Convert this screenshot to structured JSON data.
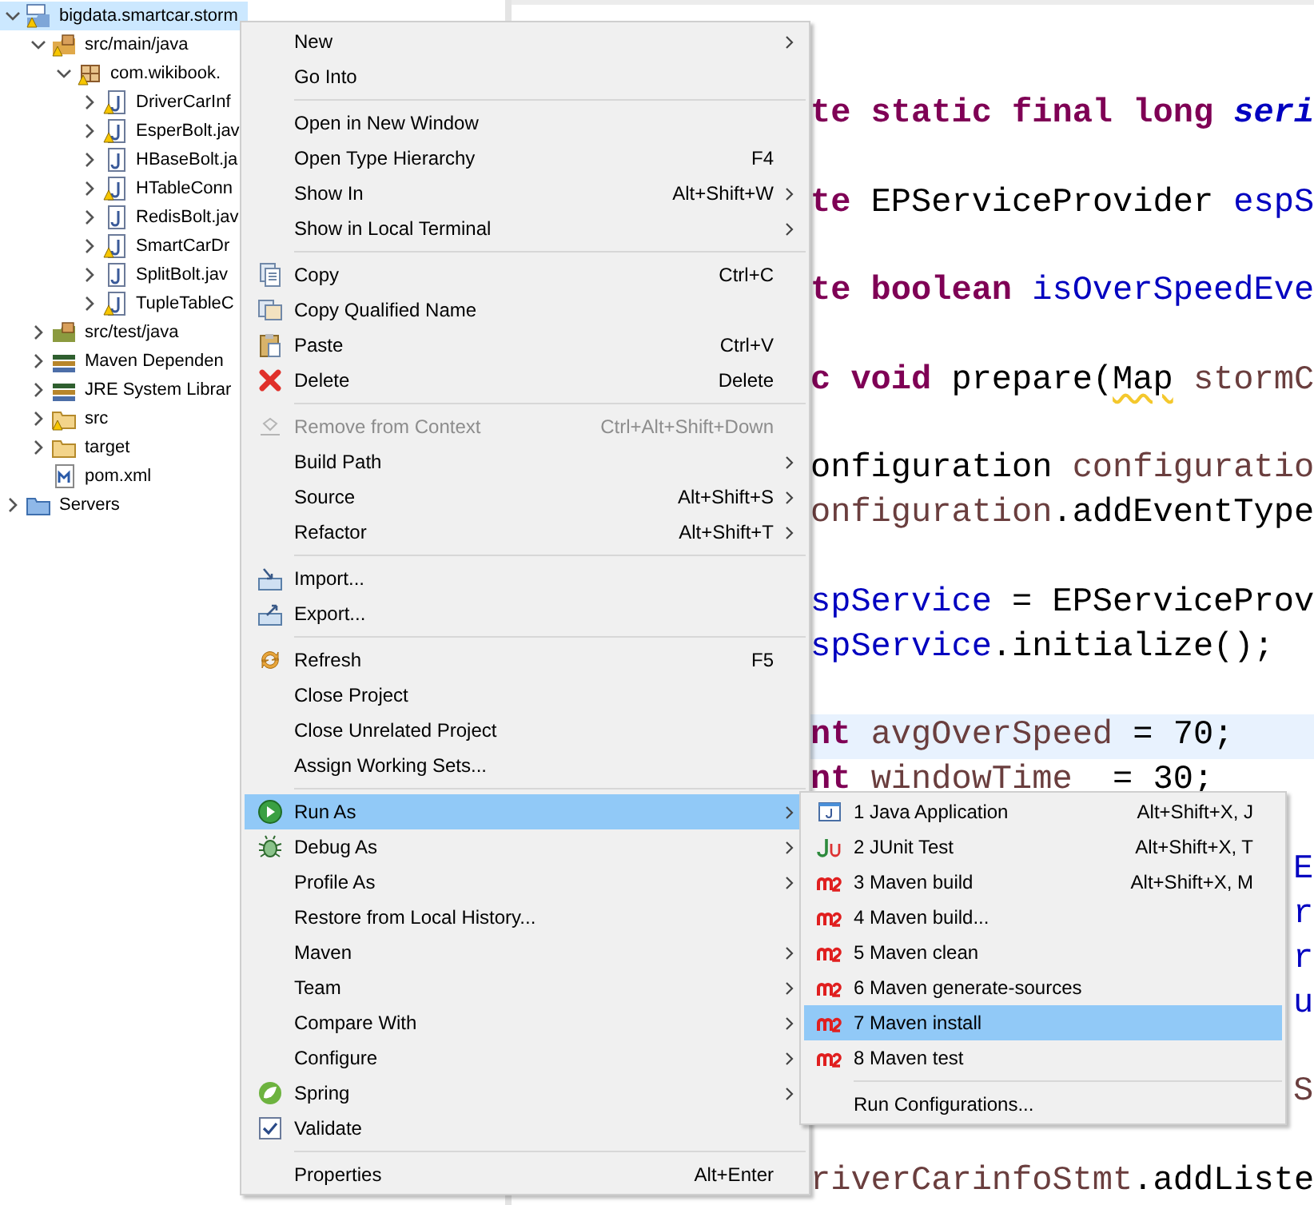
{
  "tree": [
    {
      "kind": "project",
      "label": "bigdata.smartcar.storm",
      "expanded": true,
      "selected": true,
      "warning": true,
      "children": [
        {
          "kind": "source-folder",
          "label": "src/main/java",
          "expanded": true,
          "selected": false,
          "warning": true,
          "children": [
            {
              "kind": "package",
              "label": "com.wikibook.",
              "expanded": true,
              "selected": false,
              "warning": true,
              "children": [
                {
                  "kind": "java",
                  "label": "DriverCarInf",
                  "expanded": false,
                  "selected": false,
                  "warning": true
                },
                {
                  "kind": "java",
                  "label": "EsperBolt.jav",
                  "expanded": false,
                  "selected": false,
                  "warning": true
                },
                {
                  "kind": "java",
                  "label": "HBaseBolt.ja",
                  "expanded": false,
                  "selected": false,
                  "warning": false
                },
                {
                  "kind": "java",
                  "label": "HTableConn",
                  "expanded": false,
                  "selected": false,
                  "warning": true
                },
                {
                  "kind": "java",
                  "label": "RedisBolt.jav",
                  "expanded": false,
                  "selected": false,
                  "warning": false
                },
                {
                  "kind": "java",
                  "label": "SmartCarDr",
                  "expanded": false,
                  "selected": false,
                  "warning": true
                },
                {
                  "kind": "java",
                  "label": "SplitBolt.jav",
                  "expanded": false,
                  "selected": false,
                  "warning": false
                },
                {
                  "kind": "java",
                  "label": "TupleTableC",
                  "expanded": false,
                  "selected": false,
                  "warning": true
                }
              ]
            }
          ]
        },
        {
          "kind": "test-folder",
          "label": "src/test/java",
          "expanded": false,
          "selected": false,
          "warning": false
        },
        {
          "kind": "library",
          "label": "Maven Dependen",
          "expanded": false,
          "selected": false,
          "warning": false
        },
        {
          "kind": "library",
          "label": "JRE System Librar",
          "expanded": false,
          "selected": false,
          "warning": false
        },
        {
          "kind": "folder",
          "label": "src",
          "expanded": false,
          "selected": false,
          "warning": true
        },
        {
          "kind": "folder",
          "label": "target",
          "expanded": false,
          "selected": false,
          "warning": false
        },
        {
          "kind": "xml",
          "label": "pom.xml",
          "selected": false,
          "warning": false
        }
      ]
    },
    {
      "kind": "servers",
      "label": "Servers",
      "expanded": false,
      "selected": false,
      "warning": false
    }
  ],
  "code": [
    {
      "blank_before": true,
      "edge": false,
      "current": false,
      "tokens": [
        {
          "kind": "keyword",
          "text": "te static final long "
        },
        {
          "kind": "constant",
          "text": "seri"
        }
      ]
    },
    {
      "blank_before": true,
      "edge": false,
      "current": false,
      "tokens": [
        {
          "kind": "keyword",
          "text": "te"
        },
        {
          "kind": "plain",
          "text": " EPServiceProvider "
        },
        {
          "kind": "field",
          "text": "espS"
        }
      ]
    },
    {
      "blank_before": true,
      "edge": false,
      "current": false,
      "tokens": [
        {
          "kind": "keyword",
          "text": "te boolean "
        },
        {
          "kind": "field",
          "text": "isOverSpeedEve"
        }
      ]
    },
    {
      "blank_before": true,
      "edge": false,
      "current": false,
      "tokens": [
        {
          "kind": "keyword",
          "text": "c void"
        },
        {
          "kind": "plain",
          "text": " prepare("
        },
        {
          "kind": "plain",
          "text": "Map",
          "warning": true
        },
        {
          "kind": "local",
          "text": " stormC"
        }
      ]
    },
    {
      "blank_before": true,
      "edge": false,
      "current": false,
      "tokens": [
        {
          "kind": "plain",
          "text": "onfiguration "
        },
        {
          "kind": "local",
          "text": "configuratio"
        }
      ]
    },
    {
      "blank_before": false,
      "edge": false,
      "current": false,
      "tokens": [
        {
          "kind": "local",
          "text": "onfiguration"
        },
        {
          "kind": "plain",
          "text": ".addEventType"
        }
      ]
    },
    {
      "blank_before": true,
      "edge": false,
      "current": false,
      "tokens": [
        {
          "kind": "field",
          "text": "spService"
        },
        {
          "kind": "plain",
          "text": " = EPServiceProv"
        }
      ]
    },
    {
      "blank_before": false,
      "edge": false,
      "current": false,
      "tokens": [
        {
          "kind": "field",
          "text": "spService"
        },
        {
          "kind": "plain",
          "text": ".initialize();"
        }
      ]
    },
    {
      "blank_before": true,
      "edge": false,
      "current": true,
      "tokens": [
        {
          "kind": "keyword",
          "text": "nt "
        },
        {
          "kind": "local",
          "text": "avgOverSpeed"
        },
        {
          "kind": "plain",
          "text": " = 70;"
        }
      ]
    },
    {
      "blank_before": false,
      "edge": false,
      "current": false,
      "tokens": [
        {
          "kind": "keyword",
          "text": "nt "
        },
        {
          "kind": "local",
          "text": "windowTime"
        },
        {
          "kind": "plain",
          "text": "  = 30;"
        }
      ]
    },
    {
      "blank_before": true,
      "edge": true,
      "current": false,
      "tokens": [
        {
          "kind": "field",
          "text": "E"
        }
      ]
    },
    {
      "blank_before": false,
      "edge": true,
      "current": false,
      "tokens": [
        {
          "kind": "field",
          "text": "r"
        }
      ]
    },
    {
      "blank_before": false,
      "edge": true,
      "current": false,
      "tokens": [
        {
          "kind": "field",
          "text": "r"
        }
      ]
    },
    {
      "blank_before": false,
      "edge": true,
      "current": false,
      "tokens": [
        {
          "kind": "field",
          "text": "u"
        }
      ]
    },
    {
      "blank_before": true,
      "edge": true,
      "current": false,
      "tokens": [
        {
          "kind": "local",
          "text": "S"
        }
      ]
    },
    {
      "blank_before": true,
      "edge": false,
      "current": false,
      "tokens": [
        {
          "kind": "local",
          "text": "riverCarinfoStmt"
        },
        {
          "kind": "plain",
          "text": ".addListe"
        }
      ]
    }
  ],
  "context_menu": [
    {
      "kind": "text",
      "label": "New",
      "submenu": true,
      "selected": false,
      "disabled": false
    },
    {
      "kind": "text",
      "label": "Go Into",
      "submenu": false,
      "selected": false,
      "disabled": false
    },
    {
      "kind": "separator"
    },
    {
      "kind": "text",
      "label": "Open in New Window",
      "submenu": false,
      "selected": false,
      "disabled": false
    },
    {
      "kind": "text",
      "label": "Open Type Hierarchy",
      "shortcut": "F4",
      "submenu": false,
      "selected": false,
      "disabled": false
    },
    {
      "kind": "text",
      "label": "Show In",
      "shortcut": "Alt+Shift+W",
      "submenu": true,
      "selected": false,
      "disabled": false
    },
    {
      "kind": "text",
      "label": "Show in Local Terminal",
      "submenu": true,
      "selected": false,
      "disabled": false
    },
    {
      "kind": "separator"
    },
    {
      "kind": "copy",
      "label": "Copy",
      "shortcut": "Ctrl+C",
      "submenu": false,
      "selected": false,
      "disabled": false
    },
    {
      "kind": "copyname",
      "label": "Copy Qualified Name",
      "submenu": false,
      "selected": false,
      "disabled": false
    },
    {
      "kind": "paste",
      "label": "Paste",
      "shortcut": "Ctrl+V",
      "submenu": false,
      "selected": false,
      "disabled": false
    },
    {
      "kind": "delete",
      "label": "Delete",
      "shortcut": "Delete",
      "submenu": false,
      "selected": false,
      "disabled": false
    },
    {
      "kind": "separator"
    },
    {
      "kind": "remove",
      "label": "Remove from Context",
      "shortcut": "Ctrl+Alt+Shift+Down",
      "submenu": false,
      "selected": false,
      "disabled": true
    },
    {
      "kind": "text",
      "label": "Build Path",
      "submenu": true,
      "selected": false,
      "disabled": false
    },
    {
      "kind": "text",
      "label": "Source",
      "shortcut": "Alt+Shift+S",
      "submenu": true,
      "selected": false,
      "disabled": false
    },
    {
      "kind": "text",
      "label": "Refactor",
      "shortcut": "Alt+Shift+T",
      "submenu": true,
      "selected": false,
      "disabled": false
    },
    {
      "kind": "separator"
    },
    {
      "kind": "import",
      "label": "Import...",
      "submenu": false,
      "selected": false,
      "disabled": false
    },
    {
      "kind": "export",
      "label": "Export...",
      "submenu": false,
      "selected": false,
      "disabled": false
    },
    {
      "kind": "separator"
    },
    {
      "kind": "refresh",
      "label": "Refresh",
      "shortcut": "F5",
      "submenu": false,
      "selected": false,
      "disabled": false
    },
    {
      "kind": "text",
      "label": "Close Project",
      "submenu": false,
      "selected": false,
      "disabled": false
    },
    {
      "kind": "text",
      "label": "Close Unrelated Project",
      "submenu": false,
      "selected": false,
      "disabled": false
    },
    {
      "kind": "text",
      "label": "Assign Working Sets...",
      "submenu": false,
      "selected": false,
      "disabled": false
    },
    {
      "kind": "separator"
    },
    {
      "kind": "run",
      "label": "Run As",
      "submenu": true,
      "selected": true,
      "disabled": false
    },
    {
      "kind": "debug",
      "label": "Debug As",
      "submenu": true,
      "selected": false,
      "disabled": false
    },
    {
      "kind": "text",
      "label": "Profile As",
      "submenu": true,
      "selected": false,
      "disabled": false
    },
    {
      "kind": "text",
      "label": "Restore from Local History...",
      "submenu": false,
      "selected": false,
      "disabled": false
    },
    {
      "kind": "text",
      "label": "Maven",
      "submenu": true,
      "selected": false,
      "disabled": false
    },
    {
      "kind": "text",
      "label": "Team",
      "submenu": true,
      "selected": false,
      "disabled": false
    },
    {
      "kind": "text",
      "label": "Compare With",
      "submenu": true,
      "selected": false,
      "disabled": false
    },
    {
      "kind": "text",
      "label": "Configure",
      "submenu": true,
      "selected": false,
      "disabled": false
    },
    {
      "kind": "spring",
      "label": "Spring",
      "submenu": true,
      "selected": false,
      "disabled": false
    },
    {
      "kind": "validate",
      "label": "Validate",
      "submenu": false,
      "selected": false,
      "disabled": false
    },
    {
      "kind": "separator"
    },
    {
      "kind": "text",
      "label": "Properties",
      "shortcut": "Alt+Enter",
      "submenu": false,
      "selected": false,
      "disabled": false
    }
  ],
  "run_as_menu": [
    {
      "kind": "javaapp",
      "label": "1 Java Application",
      "shortcut": "Alt+Shift+X, J",
      "selected": false
    },
    {
      "kind": "junit",
      "label": "2 JUnit Test",
      "shortcut": "Alt+Shift+X, T",
      "selected": false
    },
    {
      "kind": "maven",
      "label": "3 Maven build",
      "shortcut": "Alt+Shift+X, M",
      "selected": false
    },
    {
      "kind": "maven",
      "label": "4 Maven build...",
      "selected": false
    },
    {
      "kind": "maven",
      "label": "5 Maven clean",
      "selected": false
    },
    {
      "kind": "maven",
      "label": "6 Maven generate-sources",
      "selected": false
    },
    {
      "kind": "maven",
      "label": "7 Maven install",
      "selected": true
    },
    {
      "kind": "maven",
      "label": "8 Maven test",
      "selected": false
    },
    {
      "kind": "separator"
    },
    {
      "kind": "text",
      "label": "Run Configurations...",
      "selected": false
    }
  ]
}
